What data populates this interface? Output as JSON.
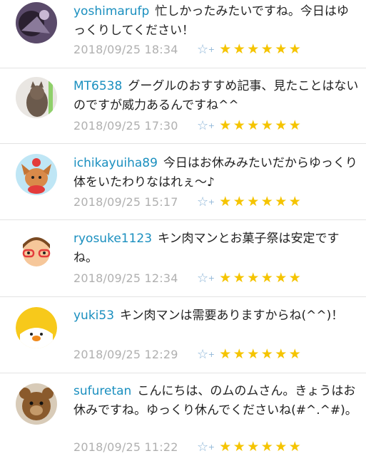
{
  "comments": [
    {
      "user": "yoshimarufp",
      "text": "忙しかったみたいですね。今日はゆっくりしてください！",
      "date": "2018/09/25 18:34",
      "stars": [
        "★",
        "★",
        "★",
        "★",
        "★",
        "★"
      ]
    },
    {
      "user": "MT6538",
      "text": "グーグルのおすすめ記事、見たことはないのですが威力あるんですね^^",
      "date": "2018/09/25 17:30",
      "stars": [
        "★",
        "★",
        "★",
        "★",
        "★",
        "★"
      ]
    },
    {
      "user": "ichikayuiha89",
      "text": "今日はお休みみたいだからゆっくり体をいたわりなはれぇ～♪",
      "date": "2018/09/25 15:17",
      "stars": [
        "★",
        "★",
        "★",
        "★",
        "★",
        "★"
      ]
    },
    {
      "user": "ryosuke1123",
      "text": "キン肉マンとお菓子祭は安定ですね。",
      "date": "2018/09/25 12:34",
      "stars": [
        "★",
        "★",
        "★",
        "★",
        "★",
        "★"
      ]
    },
    {
      "user": "yuki53",
      "text": "キン肉マンは需要ありますからね(^^)！",
      "date": "2018/09/25 12:29",
      "stars": [
        "★",
        "★",
        "★",
        "★",
        "★",
        "★"
      ]
    },
    {
      "user": "sufuretan",
      "text": "こんにちは、のムのムさん。きょうはお休みですね。ゆっくり休んでくださいね(#^.^#)。",
      "date": "2018/09/25 11:22",
      "stars": [
        "★",
        "★",
        "★",
        "★",
        "★",
        "★"
      ]
    }
  ],
  "add_star_icon": "☆",
  "add_star_plus": "+",
  "colors": {
    "username": "#1a8fbf",
    "star": "#f5c400",
    "date": "#b0b0b0"
  }
}
